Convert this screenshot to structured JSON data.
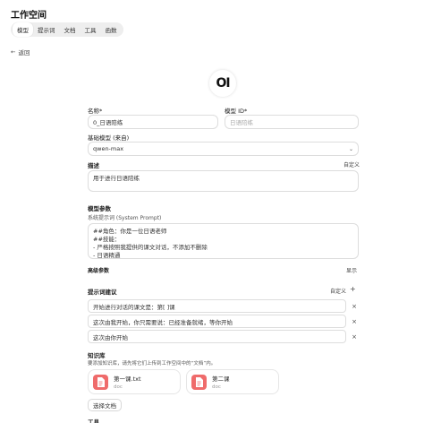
{
  "workspace": {
    "title": "工作空间"
  },
  "tabs": [
    {
      "label": "模型",
      "active": true
    },
    {
      "label": "提示词",
      "active": false
    },
    {
      "label": "文档",
      "active": false
    },
    {
      "label": "工具",
      "active": false
    },
    {
      "label": "函数",
      "active": false
    }
  ],
  "back": {
    "label": "返回"
  },
  "logo": {
    "text": "OI"
  },
  "form": {
    "name": {
      "label": "名称*",
      "value": "0_日语陪练"
    },
    "model_id": {
      "label": "模型 ID*",
      "placeholder": "日语陪练"
    },
    "base_model": {
      "label": "基础模型 (来自)",
      "value": "qwen-max"
    },
    "description": {
      "label": "描述",
      "action": "自定义",
      "value": "用于进行日语陪练"
    },
    "params_title": "模型参数",
    "system_prompt": {
      "label": "系统提示词 (System Prompt)",
      "lines": [
        "##角色：你是一位日语老师",
        "##技能：",
        "- 严格按照我提供的课文对话，不添加不删除",
        "- 日语精通",
        "- ..."
      ]
    },
    "advanced": {
      "label": "高级参数",
      "action": "显示"
    },
    "suggestions": {
      "label": "提示词建议",
      "action": "自定义",
      "add": "+",
      "items": [
        "开始进行对话的课文是：第[ ]课",
        "这次由我开始，你只需要说：已经准备就绪，等你开始",
        "这次由你开始"
      ]
    },
    "knowledge": {
      "label": "知识库",
      "hint": "要添加知识库，请先将它们上传到工作空间中的“文档”内。",
      "files": [
        {
          "name": "第一课.txt",
          "type": "doc"
        },
        {
          "name": "第二课",
          "type": "doc"
        }
      ],
      "select_button": "选择文档"
    },
    "tools": {
      "label": "工具"
    }
  }
}
